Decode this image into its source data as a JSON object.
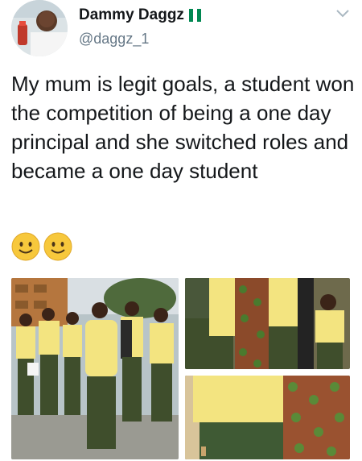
{
  "user": {
    "display_name": "Dammy Daggz",
    "handle": "@daggz_1",
    "verified_flag": "nigeria-flag-icon"
  },
  "tweet": {
    "text": "My mum is legit goals, a student won the competition of being a one day principal and she switched roles and became a one day student",
    "emojis": [
      "smiley-face-icon",
      "smiley-face-icon"
    ]
  },
  "media": {
    "count": 3
  },
  "colors": {
    "text": "#14171a",
    "secondary": "#657786",
    "uniform_yellow": "#f3e480",
    "uniform_green": "#3f4e2c"
  }
}
